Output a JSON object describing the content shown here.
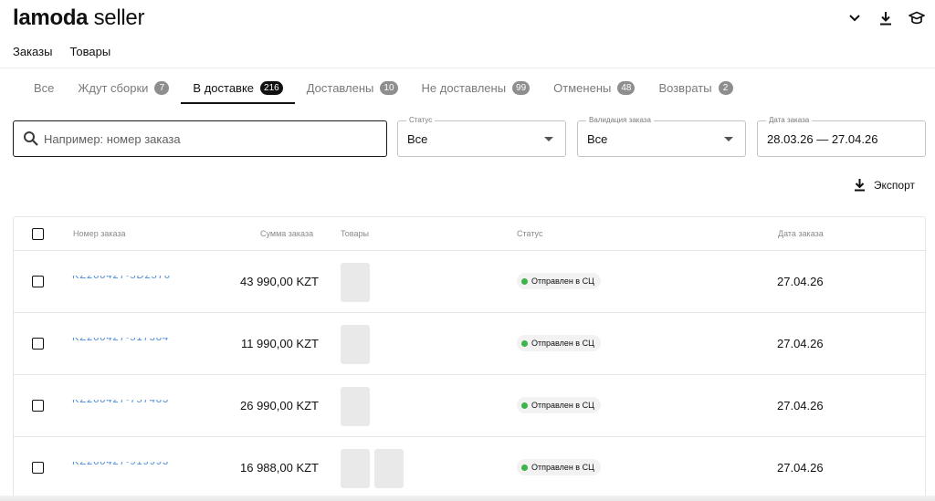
{
  "header": {
    "brand": "lamoda",
    "brand_suffix": " seller",
    "icons": [
      "chevron-down-icon",
      "download-icon",
      "graduation-cap-icon"
    ]
  },
  "nav": {
    "orders": "Заказы",
    "products": "Товары"
  },
  "tabs": [
    {
      "label": "Все",
      "count": null
    },
    {
      "label": "Ждут сборки",
      "count": "7"
    },
    {
      "label": "В доставке",
      "count": "216",
      "active": true
    },
    {
      "label": "Доставлены",
      "count": "10"
    },
    {
      "label": "Не доставлены",
      "count": "99"
    },
    {
      "label": "Отменены",
      "count": "48"
    },
    {
      "label": "Возвраты",
      "count": "2"
    }
  ],
  "filters": {
    "search_placeholder": "Например: номер заказа",
    "status": {
      "label": "Статус",
      "value": "Все"
    },
    "validation": {
      "label": "Валидация заказа",
      "value": "Все"
    },
    "date": {
      "label": "Дата заказа",
      "value": "28.03.26 — 27.04.26"
    }
  },
  "export_label": "Экспорт",
  "table": {
    "columns": {
      "order": "Номер заказа",
      "amount": "Сумма заказа",
      "items": "Товары",
      "status": "Статус",
      "date": "Дата заказа"
    },
    "rows": [
      {
        "amount": "43 990,00 KZT",
        "thumbs": 1,
        "status": "Отправлен в СЦ",
        "date": "27.04.26"
      },
      {
        "amount": "11 990,00 KZT",
        "thumbs": 1,
        "status": "Отправлен в СЦ",
        "date": "27.04.26"
      },
      {
        "amount": "26 990,00 KZT",
        "thumbs": 1,
        "status": "Отправлен в СЦ",
        "date": "27.04.26"
      },
      {
        "amount": "16 988,00 KZT",
        "thumbs": 2,
        "status": "Отправлен в СЦ",
        "date": "27.04.26"
      }
    ]
  },
  "colors": {
    "link": "#4a8ad8",
    "status_dot": "#3bb54a",
    "active_tab": "#111111"
  }
}
